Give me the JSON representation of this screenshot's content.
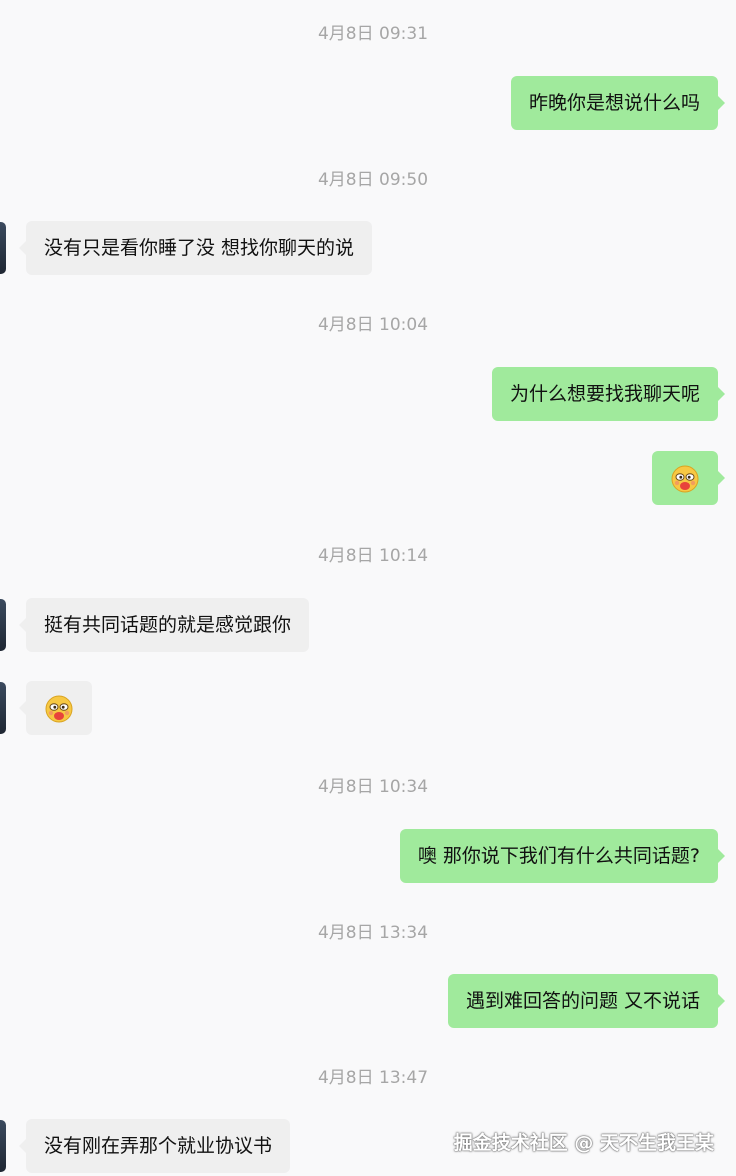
{
  "messages": [
    {
      "timestamp": "4月8日 09:31",
      "side": "out",
      "text": "昨晚你是想说什么吗"
    },
    {
      "timestamp": "4月8日 09:50",
      "side": "in",
      "text": "没有只是看你睡了没 想找你聊天的说"
    },
    {
      "timestamp": "4月8日 10:04",
      "side": "out",
      "text": "为什么想要找我聊天呢"
    },
    {
      "side": "out",
      "emoji": "shy-face-emoji"
    },
    {
      "timestamp": "4月8日 10:14",
      "side": "in",
      "text": "挺有共同话题的就是感觉跟你"
    },
    {
      "side": "in",
      "emoji": "shy-face-emoji"
    },
    {
      "timestamp": "4月8日 10:34",
      "side": "out",
      "text": "噢 那你说下我们有什么共同话题?"
    },
    {
      "timestamp": "4月8日 13:34",
      "side": "out",
      "text": "遇到难回答的问题 又不说话"
    },
    {
      "timestamp": "4月8日 13:47",
      "side": "in",
      "text": "没有刚在弄那个就业协议书"
    }
  ],
  "watermark": "掘金技术社区 @ 天不生我王某",
  "colors": {
    "outgoing_bubble": "#a0ea9c",
    "incoming_bubble": "#efefef",
    "timestamp_text": "#a6a6a6",
    "background": "#f9f9fa"
  }
}
